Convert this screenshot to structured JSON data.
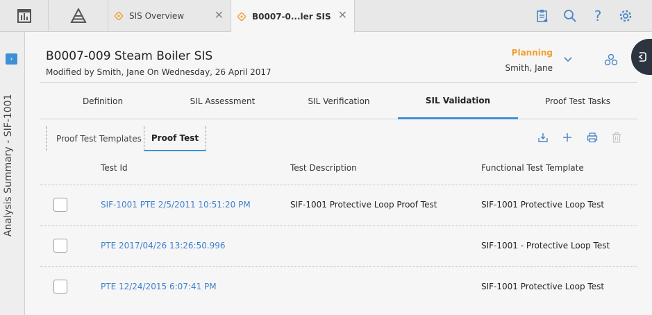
{
  "topbar": {
    "tabs": [
      {
        "label": "SIS Overview"
      },
      {
        "label": "B0007-0...ler SIS"
      }
    ]
  },
  "leftpanel": {
    "label": "Analysis Summary - SIF-1001"
  },
  "header": {
    "title": "B0007-009 Steam Boiler SIS",
    "subtitle": "Modified by Smith, Jane On Wednesday, 26 April 2017",
    "state": "Planning",
    "state_user": "Smith, Jane"
  },
  "main_tabs": [
    {
      "label": "Definition"
    },
    {
      "label": "SIL Assessment"
    },
    {
      "label": "SIL Verification"
    },
    {
      "label": "SIL Validation"
    },
    {
      "label": "Proof Test Tasks"
    }
  ],
  "sub_tabs": [
    {
      "label": "Proof Test Templates"
    },
    {
      "label": "Proof Test"
    }
  ],
  "table": {
    "headers": [
      "Test Id",
      "Test Description",
      "Functional Test Template"
    ],
    "rows": [
      {
        "id": "SIF-1001 PTE 2/5/2011 10:51:20 PM",
        "desc": "SIF-1001 Protective Loop Proof Test",
        "template": "SIF-1001 Protective Loop Test"
      },
      {
        "id": "PTE 2017/04/26 13:26:50.996",
        "desc": "",
        "template": "SIF-1001 - Protective Loop Test"
      },
      {
        "id": "PTE 12/24/2015 6:07:41 PM",
        "desc": "",
        "template": "SIF-1001 Protective Loop Test"
      }
    ]
  },
  "colors": {
    "accent": "#3e8fd6",
    "state": "#f0a030",
    "link": "#3e7fd0"
  }
}
